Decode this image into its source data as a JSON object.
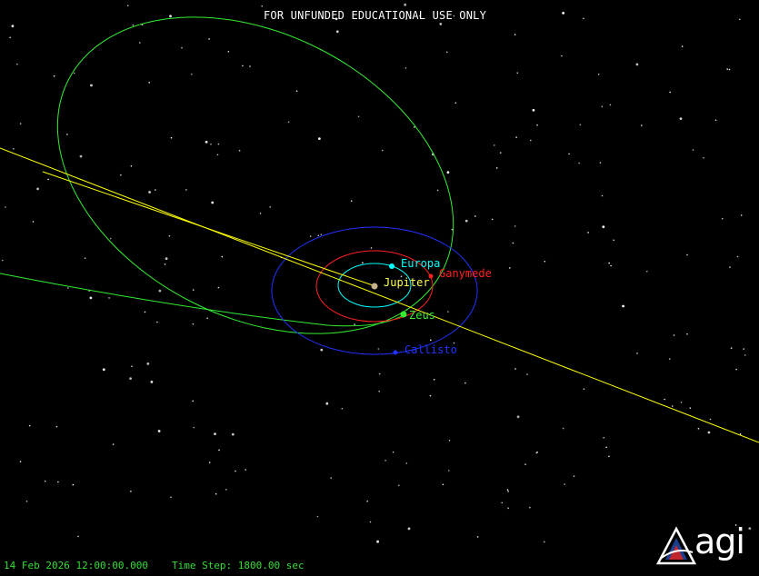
{
  "banner": "FOR UNFUNDED EDUCATIONAL USE ONLY",
  "status": {
    "datetime": "14 Feb 2026 12:00:00.000",
    "time_step": "Time Step: 1800.00 sec"
  },
  "logo_text": "agi",
  "bodies": {
    "jupiter": {
      "label": "Jupiter",
      "color": "#ffff55"
    },
    "europa": {
      "label": "Europa",
      "color": "#00ffff"
    },
    "ganymede": {
      "label": "Ganymede",
      "color": "#ff2222"
    },
    "callisto": {
      "label": "Callisto",
      "color": "#2233ff"
    },
    "zeus": {
      "label": "Zeus",
      "color": "#33ee33"
    }
  },
  "colors": {
    "background": "#000000",
    "trajectory": "#ffff00",
    "spacecraft_orbit": "#33ee33",
    "status_text": "#33dd33",
    "jupiter_disk": "#c8b48a"
  }
}
